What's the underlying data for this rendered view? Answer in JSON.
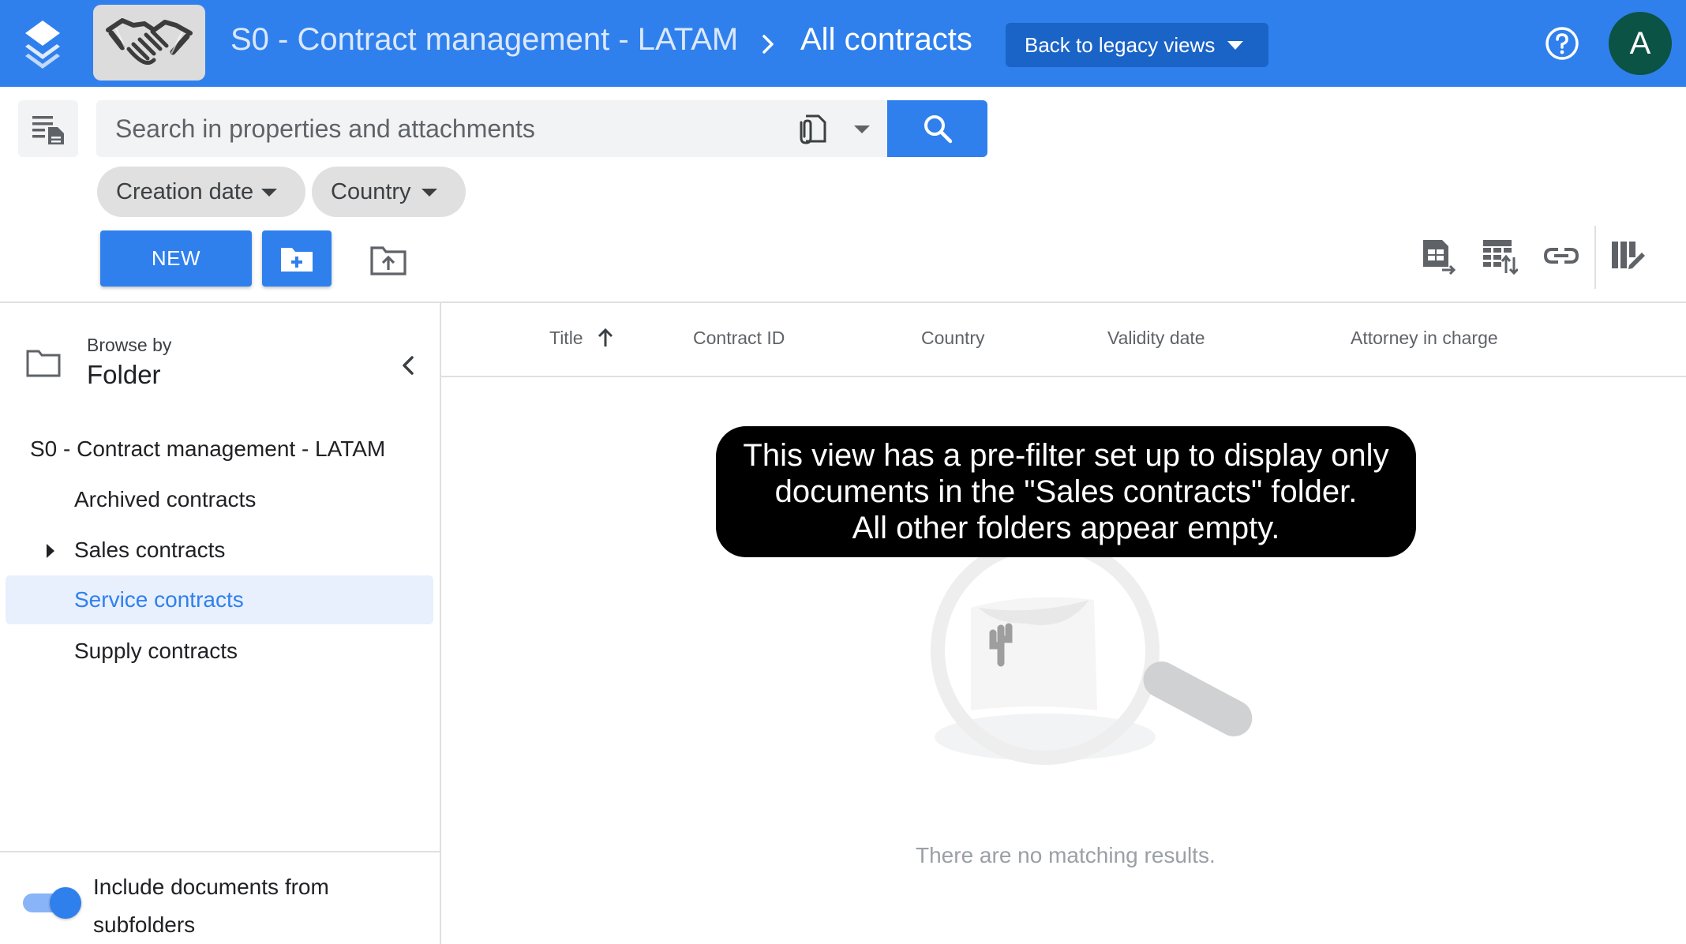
{
  "header": {
    "app_title": "S0 - Contract management - LATAM",
    "breadcrumb_separator": ">",
    "view_title": "All contracts",
    "legacy_button": "Back to legacy views",
    "avatar_initial": "A",
    "brand_color": "#2f80ed"
  },
  "search": {
    "placeholder": "Search in properties and attachments",
    "value": ""
  },
  "filters": [
    {
      "label": "Creation date"
    },
    {
      "label": "Country"
    }
  ],
  "actions": {
    "new_label": "NEW"
  },
  "browse": {
    "label": "Browse by",
    "value": "Folder"
  },
  "tree": {
    "root": "S0 - Contract management - LATAM",
    "items": [
      {
        "label": "Archived contracts",
        "expandable": false,
        "selected": false
      },
      {
        "label": "Sales contracts",
        "expandable": true,
        "selected": false
      },
      {
        "label": "Service contracts",
        "expandable": false,
        "selected": true
      },
      {
        "label": "Supply contracts",
        "expandable": false,
        "selected": false
      }
    ]
  },
  "subfolders_toggle": {
    "label": "Include documents from subfolders",
    "on": true
  },
  "table": {
    "columns": [
      "Title",
      "Contract ID",
      "Country",
      "Validity date",
      "Attorney in charge"
    ],
    "sort_column": "Title",
    "sort_direction": "ascending",
    "rows": []
  },
  "empty_state": {
    "message": "There are no matching results."
  },
  "callout": {
    "lines": [
      "This view has a pre-filter set up to display only",
      "documents in the \"Sales contracts\" folder.",
      "All other folders appear empty."
    ]
  },
  "icons": {
    "app_logo": "stacked-diamonds-icon",
    "app_thumbnail": "handshake-icon",
    "help": "help-circle-icon",
    "panel_toggle": "list-document-icon",
    "attachment": "attachment-file-icon",
    "search": "search-icon",
    "new_folder": "create-folder-icon",
    "upload": "upload-folder-icon",
    "export_excel": "export-sheet-icon",
    "import_table": "import-table-icon",
    "copy_link": "link-icon",
    "edit_columns": "edit-columns-icon"
  }
}
